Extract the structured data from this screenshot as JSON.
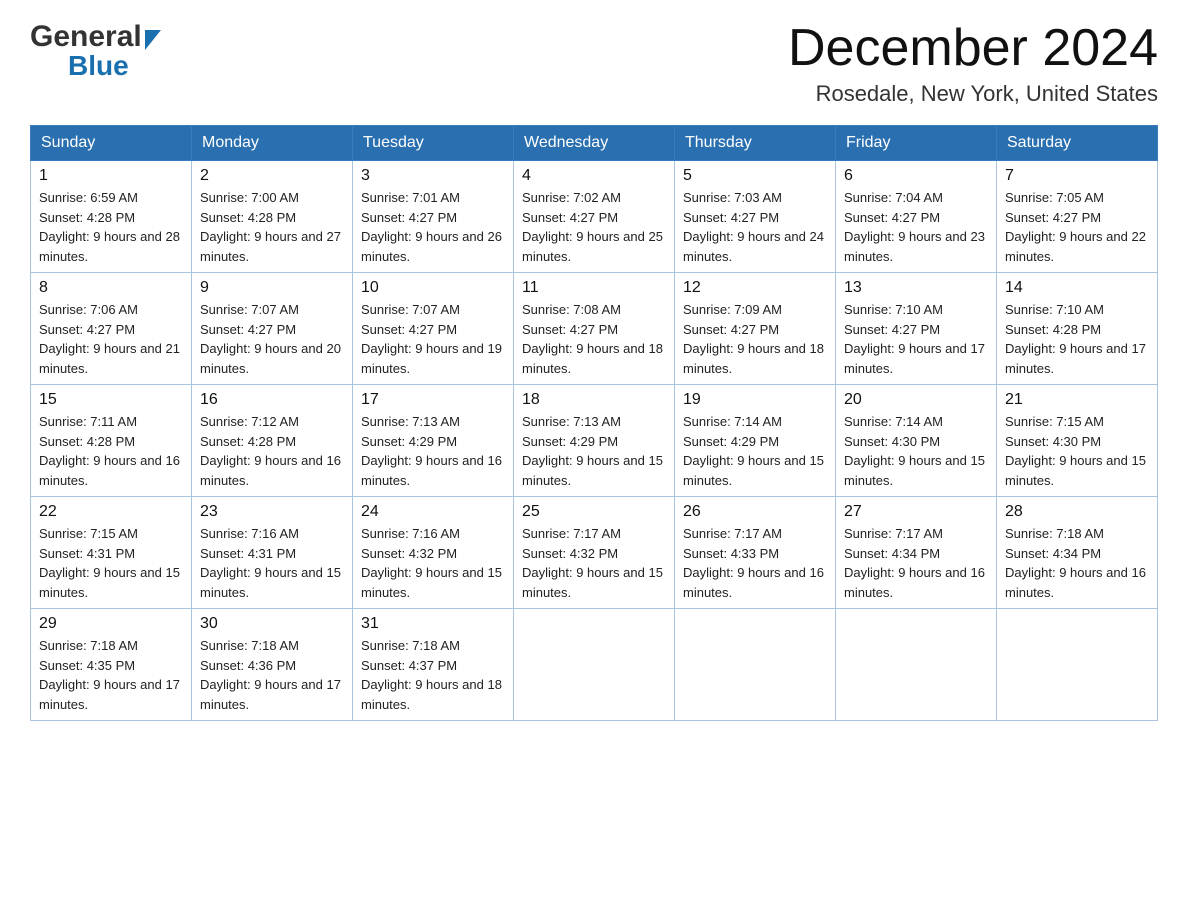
{
  "header": {
    "title": "December 2024",
    "location": "Rosedale, New York, United States",
    "logo_general": "General",
    "logo_blue": "Blue"
  },
  "days_of_week": [
    "Sunday",
    "Monday",
    "Tuesday",
    "Wednesday",
    "Thursday",
    "Friday",
    "Saturday"
  ],
  "weeks": [
    [
      {
        "day": "1",
        "sunrise": "6:59 AM",
        "sunset": "4:28 PM",
        "daylight": "9 hours and 28 minutes."
      },
      {
        "day": "2",
        "sunrise": "7:00 AM",
        "sunset": "4:28 PM",
        "daylight": "9 hours and 27 minutes."
      },
      {
        "day": "3",
        "sunrise": "7:01 AM",
        "sunset": "4:27 PM",
        "daylight": "9 hours and 26 minutes."
      },
      {
        "day": "4",
        "sunrise": "7:02 AM",
        "sunset": "4:27 PM",
        "daylight": "9 hours and 25 minutes."
      },
      {
        "day": "5",
        "sunrise": "7:03 AM",
        "sunset": "4:27 PM",
        "daylight": "9 hours and 24 minutes."
      },
      {
        "day": "6",
        "sunrise": "7:04 AM",
        "sunset": "4:27 PM",
        "daylight": "9 hours and 23 minutes."
      },
      {
        "day": "7",
        "sunrise": "7:05 AM",
        "sunset": "4:27 PM",
        "daylight": "9 hours and 22 minutes."
      }
    ],
    [
      {
        "day": "8",
        "sunrise": "7:06 AM",
        "sunset": "4:27 PM",
        "daylight": "9 hours and 21 minutes."
      },
      {
        "day": "9",
        "sunrise": "7:07 AM",
        "sunset": "4:27 PM",
        "daylight": "9 hours and 20 minutes."
      },
      {
        "day": "10",
        "sunrise": "7:07 AM",
        "sunset": "4:27 PM",
        "daylight": "9 hours and 19 minutes."
      },
      {
        "day": "11",
        "sunrise": "7:08 AM",
        "sunset": "4:27 PM",
        "daylight": "9 hours and 18 minutes."
      },
      {
        "day": "12",
        "sunrise": "7:09 AM",
        "sunset": "4:27 PM",
        "daylight": "9 hours and 18 minutes."
      },
      {
        "day": "13",
        "sunrise": "7:10 AM",
        "sunset": "4:27 PM",
        "daylight": "9 hours and 17 minutes."
      },
      {
        "day": "14",
        "sunrise": "7:10 AM",
        "sunset": "4:28 PM",
        "daylight": "9 hours and 17 minutes."
      }
    ],
    [
      {
        "day": "15",
        "sunrise": "7:11 AM",
        "sunset": "4:28 PM",
        "daylight": "9 hours and 16 minutes."
      },
      {
        "day": "16",
        "sunrise": "7:12 AM",
        "sunset": "4:28 PM",
        "daylight": "9 hours and 16 minutes."
      },
      {
        "day": "17",
        "sunrise": "7:13 AM",
        "sunset": "4:29 PM",
        "daylight": "9 hours and 16 minutes."
      },
      {
        "day": "18",
        "sunrise": "7:13 AM",
        "sunset": "4:29 PM",
        "daylight": "9 hours and 15 minutes."
      },
      {
        "day": "19",
        "sunrise": "7:14 AM",
        "sunset": "4:29 PM",
        "daylight": "9 hours and 15 minutes."
      },
      {
        "day": "20",
        "sunrise": "7:14 AM",
        "sunset": "4:30 PM",
        "daylight": "9 hours and 15 minutes."
      },
      {
        "day": "21",
        "sunrise": "7:15 AM",
        "sunset": "4:30 PM",
        "daylight": "9 hours and 15 minutes."
      }
    ],
    [
      {
        "day": "22",
        "sunrise": "7:15 AM",
        "sunset": "4:31 PM",
        "daylight": "9 hours and 15 minutes."
      },
      {
        "day": "23",
        "sunrise": "7:16 AM",
        "sunset": "4:31 PM",
        "daylight": "9 hours and 15 minutes."
      },
      {
        "day": "24",
        "sunrise": "7:16 AM",
        "sunset": "4:32 PM",
        "daylight": "9 hours and 15 minutes."
      },
      {
        "day": "25",
        "sunrise": "7:17 AM",
        "sunset": "4:32 PM",
        "daylight": "9 hours and 15 minutes."
      },
      {
        "day": "26",
        "sunrise": "7:17 AM",
        "sunset": "4:33 PM",
        "daylight": "9 hours and 16 minutes."
      },
      {
        "day": "27",
        "sunrise": "7:17 AM",
        "sunset": "4:34 PM",
        "daylight": "9 hours and 16 minutes."
      },
      {
        "day": "28",
        "sunrise": "7:18 AM",
        "sunset": "4:34 PM",
        "daylight": "9 hours and 16 minutes."
      }
    ],
    [
      {
        "day": "29",
        "sunrise": "7:18 AM",
        "sunset": "4:35 PM",
        "daylight": "9 hours and 17 minutes."
      },
      {
        "day": "30",
        "sunrise": "7:18 AM",
        "sunset": "4:36 PM",
        "daylight": "9 hours and 17 minutes."
      },
      {
        "day": "31",
        "sunrise": "7:18 AM",
        "sunset": "4:37 PM",
        "daylight": "9 hours and 18 minutes."
      },
      null,
      null,
      null,
      null
    ]
  ]
}
